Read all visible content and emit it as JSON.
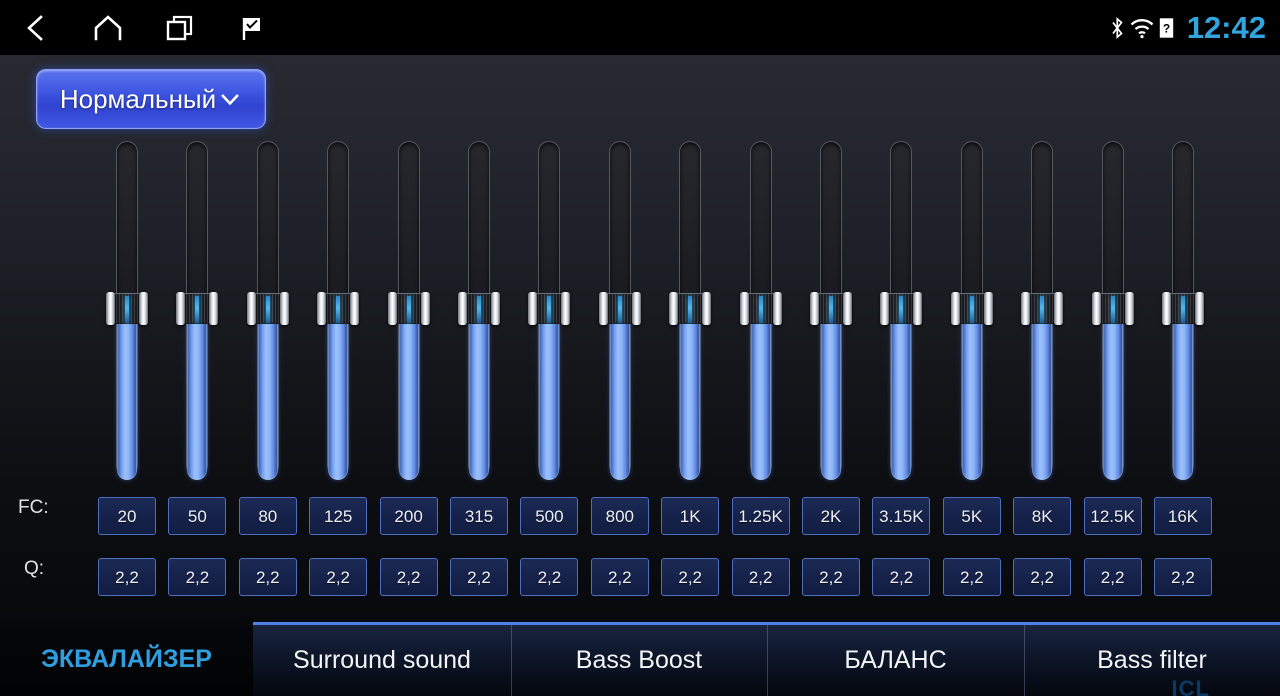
{
  "statusbar": {
    "nav": [
      {
        "name": "back-icon",
        "label": "Back"
      },
      {
        "name": "home-icon",
        "label": "Home"
      },
      {
        "name": "recents-icon",
        "label": "Recent apps"
      },
      {
        "name": "flag-icon",
        "label": "Flag"
      }
    ],
    "system_icons": [
      {
        "name": "bluetooth-icon",
        "label": "Bluetooth"
      },
      {
        "name": "wifi-icon",
        "label": "Wi-Fi"
      },
      {
        "name": "sim-unknown-icon",
        "label": "?"
      }
    ],
    "time": "12:42",
    "time_color": "#33a5de"
  },
  "preset": {
    "label": "Нормальный",
    "chevron": "chevron-down-icon",
    "accent": "#3c53e0"
  },
  "equalizer": {
    "bands": 16,
    "fc_label": "FC:",
    "q_label": "Q:",
    "fc_values": [
      "20",
      "50",
      "80",
      "125",
      "200",
      "315",
      "500",
      "800",
      "1K",
      "1.25K",
      "2K",
      "3.15K",
      "5K",
      "8K",
      "12.5K",
      "16K"
    ],
    "q_values": [
      "2,2",
      "2,2",
      "2,2",
      "2,2",
      "2,2",
      "2,2",
      "2,2",
      "2,2",
      "2,2",
      "2,2",
      "2,2",
      "2,2",
      "2,2",
      "2,2",
      "2,2",
      "2,2"
    ],
    "slider_percent": [
      50,
      50,
      50,
      50,
      50,
      50,
      50,
      50,
      50,
      50,
      50,
      50,
      50,
      50,
      50,
      50
    ],
    "fill_color": "#8fb7f9",
    "chip_border": "#4f6ec0"
  },
  "tabs": [
    {
      "label": "ЭКВАЛАЙЗЕР",
      "active": true
    },
    {
      "label": "Surround sound",
      "active": false
    },
    {
      "label": "Bass Boost",
      "active": false
    },
    {
      "label": "БАЛАНС",
      "active": false
    },
    {
      "label": "Bass filter",
      "active": false
    }
  ],
  "corner_mark": "ICL"
}
